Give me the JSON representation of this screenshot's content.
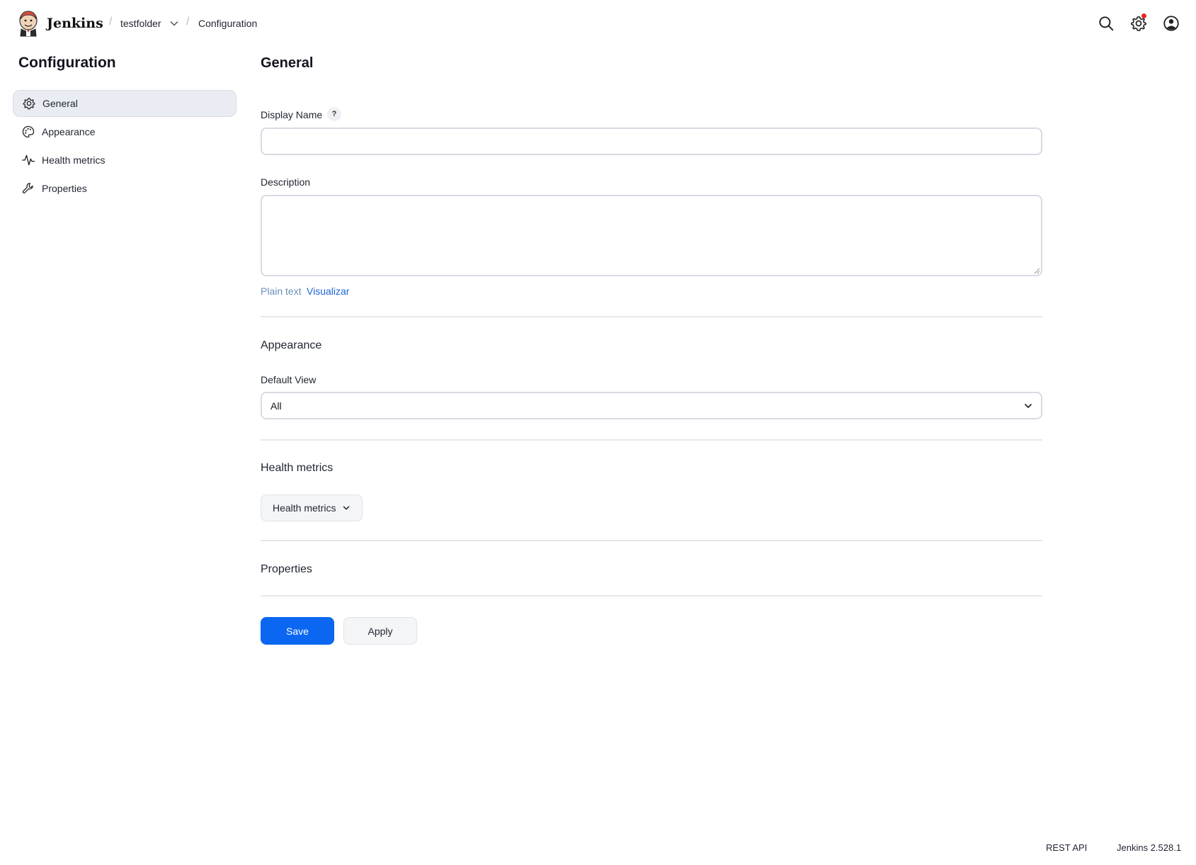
{
  "header": {
    "brand": "Jenkins",
    "breadcrumbs": [
      {
        "label": "testfolder"
      },
      {
        "label": "Configuration"
      }
    ],
    "icons": [
      "search-icon",
      "gear-icon",
      "user-icon"
    ]
  },
  "sidebar": {
    "title": "Configuration",
    "items": [
      {
        "label": "General",
        "icon": "gear-icon",
        "active": true
      },
      {
        "label": "Appearance",
        "icon": "palette-icon"
      },
      {
        "label": "Health metrics",
        "icon": "pulse-icon"
      },
      {
        "label": "Properties",
        "icon": "wrench-icon"
      }
    ]
  },
  "main": {
    "title": "General",
    "display_name": {
      "label": "Display Name",
      "help": "?",
      "value": ""
    },
    "description": {
      "label": "Description",
      "value": "",
      "hint_plain": "Plain text",
      "hint_link": "Visualizar"
    },
    "appearance": {
      "heading": "Appearance",
      "default_view_label": "Default View",
      "default_view_value": "All"
    },
    "health_metrics": {
      "heading": "Health metrics",
      "button_label": "Health metrics"
    },
    "properties": {
      "heading": "Properties"
    },
    "buttons": {
      "save": "Save",
      "apply": "Apply"
    }
  },
  "footer": {
    "rest_api": "REST API",
    "version": "Jenkins 2.528.1"
  },
  "colors": {
    "primary": "#0b67f2",
    "link": "#1b66d6",
    "notification": "#e5252a"
  }
}
